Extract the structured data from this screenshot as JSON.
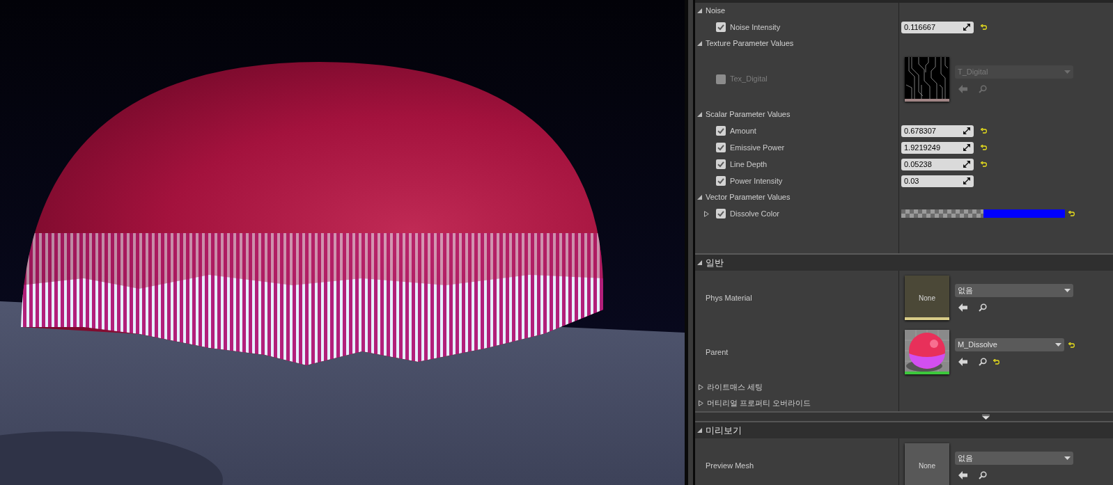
{
  "parameter_groups": [
    {
      "title": "Noise",
      "expanded": true,
      "params": [
        {
          "kind": "scalar",
          "name": "Noise Intensity",
          "checked": true,
          "value": "0.116667",
          "reset": true
        }
      ]
    },
    {
      "title": "Texture Parameter Values",
      "expanded": true,
      "params": [
        {
          "kind": "texture",
          "name": "Tex_Digital",
          "checked": false,
          "asset": "T_Digital"
        }
      ]
    },
    {
      "title": "Scalar Parameter Values",
      "expanded": true,
      "params": [
        {
          "kind": "scalar",
          "name": "Amount",
          "checked": true,
          "value": "0.678307",
          "reset": true
        },
        {
          "kind": "scalar",
          "name": "Emissive Power",
          "checked": true,
          "value": "1.9219249",
          "reset": true
        },
        {
          "kind": "scalar",
          "name": "Line Depth",
          "checked": true,
          "value": "0.05238",
          "reset": true
        },
        {
          "kind": "scalar",
          "name": "Power Intensity",
          "checked": true,
          "value": "0.03",
          "reset": false
        }
      ]
    },
    {
      "title": "Vector Parameter Values",
      "expanded": true,
      "params": [
        {
          "kind": "color",
          "name": "Dissolve Color",
          "checked": true,
          "expanded": false,
          "color": "#0000ff",
          "reset": true
        }
      ]
    }
  ],
  "categories": [
    {
      "title": "일반",
      "expanded": true,
      "rows": [
        {
          "kind": "physical_material",
          "label": "Phys Material",
          "thumbnail_text": "None",
          "asset": "없음",
          "reset": false,
          "browse_reset": false
        },
        {
          "kind": "material",
          "label": "Parent",
          "asset": "M_Dissolve",
          "reset": true,
          "browse_reset": true
        }
      ],
      "subcategories": [
        {
          "title": "라이트매스 세팅",
          "expanded": false
        },
        {
          "title": "머티리얼 프로퍼티 오버라이드",
          "expanded": false
        }
      ]
    },
    {
      "title": "미리보기",
      "expanded": true,
      "rows": [
        {
          "kind": "static_mesh",
          "label": "Preview Mesh",
          "thumbnail_text": "None",
          "asset": "없음",
          "reset": false,
          "browse_reset": false
        }
      ]
    }
  ]
}
